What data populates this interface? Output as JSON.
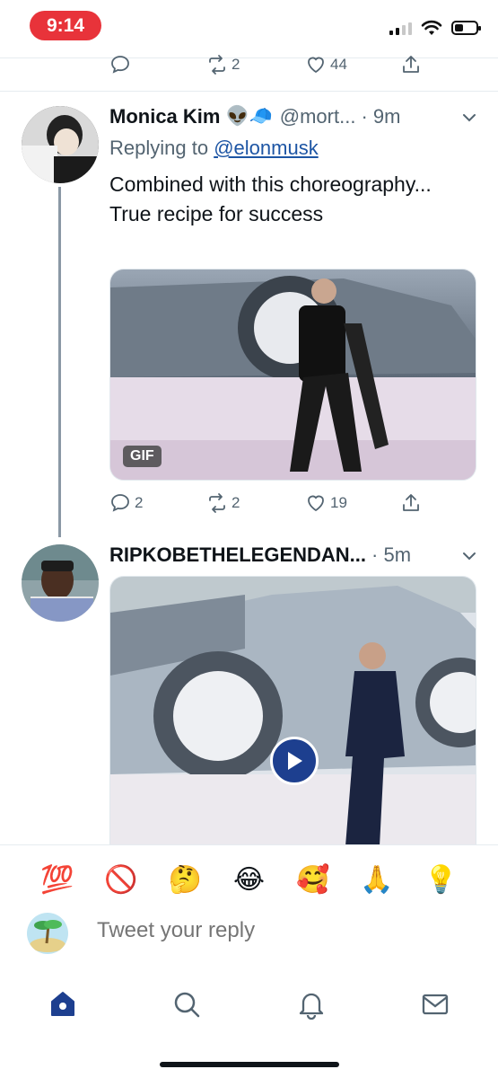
{
  "status_bar": {
    "time": "9:14"
  },
  "top_actions": {
    "comments": "",
    "retweets": "2",
    "likes": "44"
  },
  "tweet1": {
    "name": "Monica Kim",
    "badges": "👽🧢",
    "handle": "@mort...",
    "time": "· 9m",
    "replying_prefix": "Replying to",
    "replying_to": "@elonmusk",
    "text": "Combined with this choreography... True recipe for success",
    "media_badge": "GIF",
    "comments": "2",
    "retweets": "2",
    "likes": "19"
  },
  "tweet2": {
    "name": "RIPKOBETHELEGENDAN...",
    "time": "· 5m"
  },
  "emoji_bar": [
    "💯",
    "🚫",
    "🤔",
    "😂",
    "🥰",
    "🙏",
    "💡"
  ],
  "reply": {
    "placeholder": "Tweet your reply"
  },
  "colors": {
    "accent": "#1d55a4",
    "time_pill": "#e8333a",
    "muted": "#536471"
  }
}
